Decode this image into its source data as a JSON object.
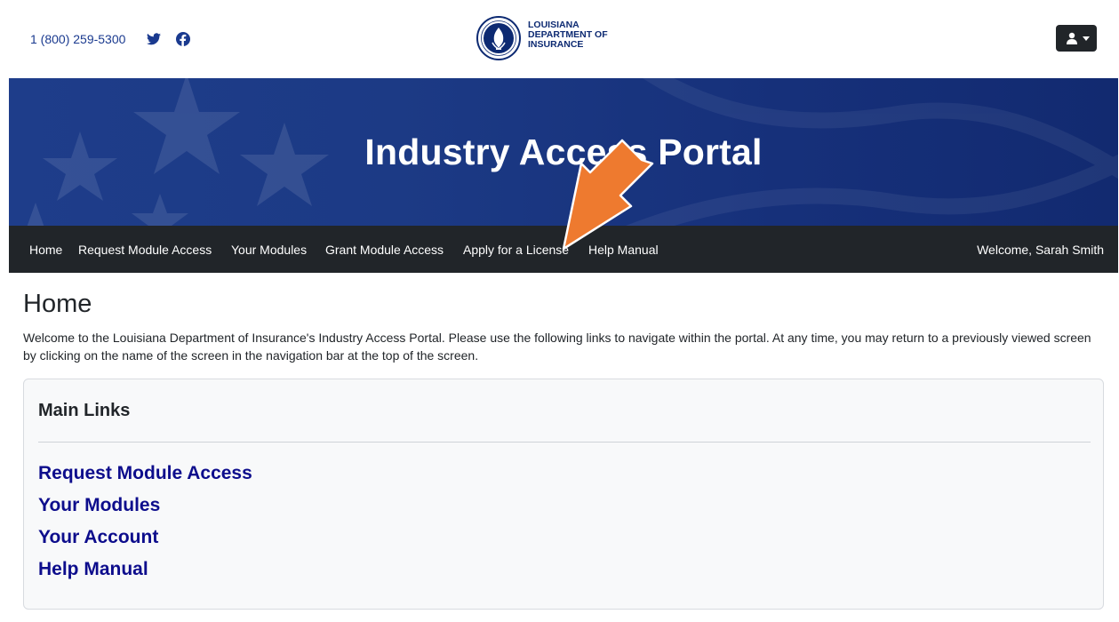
{
  "header": {
    "phone": "1 (800) 259-5300",
    "logo_lines": [
      "LOUISIANA",
      "DEPARTMENT OF",
      "INSURANCE"
    ],
    "seal_text": "STATE OF LOUISIANA · DEPARTMENT OF INSURANCE"
  },
  "banner": {
    "title": "Industry Access Portal"
  },
  "nav": {
    "items": [
      "Home",
      "Request Module Access",
      "Your Modules",
      "Grant Module Access",
      "Apply for a License",
      "Help Manual"
    ],
    "welcome": "Welcome, Sarah Smith"
  },
  "main": {
    "title": "Home",
    "intro": "Welcome to the Louisiana Department of Insurance's Industry Access Portal. Please use the following links to navigate within the portal. At any time, you may return to a previously viewed screen by clicking on the name of the screen in the navigation bar at the top of the screen.",
    "card": {
      "title": "Main Links",
      "links": [
        "Request Module Access",
        "Your Modules",
        "Your Account",
        "Help Manual"
      ]
    }
  },
  "colors": {
    "banner_blue": "#1c3a85",
    "navbar": "#212529",
    "link": "#0d0d8c",
    "arrow": "#ee7a2f"
  }
}
